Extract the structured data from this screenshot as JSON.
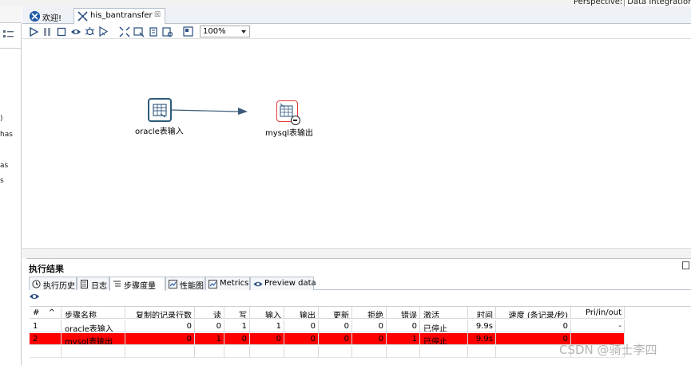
{
  "perspective": {
    "label": "Perspective:",
    "button": "Data Integration"
  },
  "left_panel": {
    "fragments": [
      ")",
      "has",
      "as",
      "s"
    ]
  },
  "tabs": [
    {
      "label": "欢迎!",
      "icon": "spoon-icon"
    },
    {
      "label": "his_bantransfer",
      "icon": "transformation-icon",
      "close": "☒"
    }
  ],
  "toolbar": {
    "zoom": "100%"
  },
  "canvas": {
    "steps": [
      {
        "name": "oracle表输入",
        "type": "table-input"
      },
      {
        "name": "mysql表输出",
        "type": "table-output",
        "status": "error"
      }
    ]
  },
  "results": {
    "title": "执行结果",
    "tabs": [
      "执行历史",
      "日志",
      "步骤度量",
      "性能图",
      "Metrics",
      "Preview data"
    ],
    "active_tab": "步骤度量",
    "columns": [
      "#",
      "步骤名称",
      "复制的记录行数",
      "读",
      "写",
      "输入",
      "输出",
      "更新",
      "拒绝",
      "错误",
      "激活",
      "时间",
      "速度 (条记录/秒)",
      "Pri/in/out"
    ],
    "sort_indicator": "^",
    "rows": [
      {
        "cells": [
          "1",
          "oracle表输入",
          "0",
          "0",
          "1",
          "1",
          "0",
          "0",
          "0",
          "0",
          "已停止",
          "9.9s",
          "0",
          "-"
        ],
        "highlight": ""
      },
      {
        "cells": [
          "2",
          "mysql表输出",
          "0",
          "1",
          "0",
          "0",
          "0",
          "0",
          "0",
          "1",
          "已停止",
          "9.9s",
          "0",
          ""
        ],
        "highlight": "#ff0000"
      }
    ]
  },
  "watermark": "CSDN @骑士李四",
  "colors": {
    "accent": "#1e5aa8",
    "error": "#ff0000",
    "hop": "#3b5a78",
    "node_border_ok": "#2c5a7a",
    "node_border_error": "#e23b3b"
  }
}
